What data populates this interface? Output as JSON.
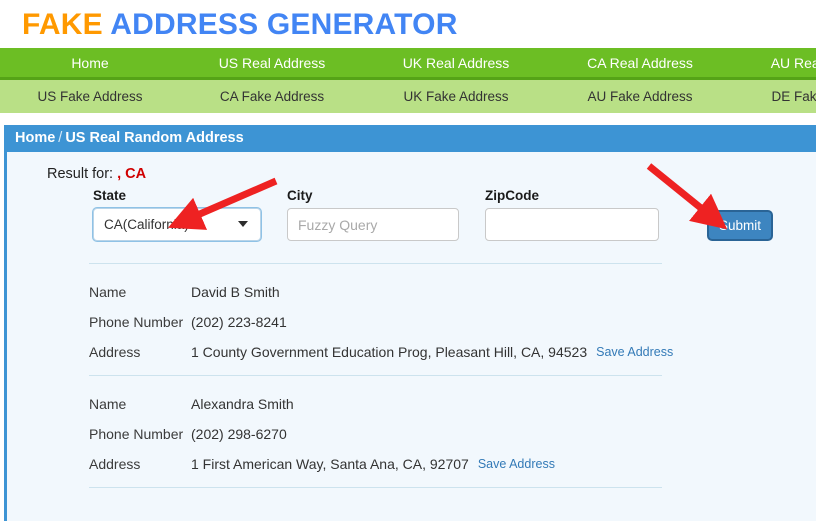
{
  "logo": {
    "part1": "FAKE",
    "part2": " ADDRESS GENERATOR"
  },
  "nav": {
    "primary": [
      {
        "label": "Home"
      },
      {
        "label": "US Real Address"
      },
      {
        "label": "UK Real Address"
      },
      {
        "label": "CA Real Address"
      },
      {
        "label": "AU Real Address"
      }
    ],
    "secondary": [
      {
        "label": "US Fake Address"
      },
      {
        "label": "CA Fake Address"
      },
      {
        "label": "UK Fake Address"
      },
      {
        "label": "AU Fake Address"
      },
      {
        "label": "DE Fake Address"
      }
    ]
  },
  "breadcrumb": {
    "home": "Home",
    "separator": "/",
    "current": "US Real Random Address"
  },
  "result_for": {
    "prefix": "Result for:",
    "value": ", CA"
  },
  "form": {
    "state": {
      "label": "State",
      "value": "CA(California)"
    },
    "city": {
      "label": "City",
      "value": "",
      "placeholder": "Fuzzy Query"
    },
    "zipcode": {
      "label": "ZipCode",
      "value": "",
      "placeholder": ""
    },
    "submit": {
      "label": "Submit"
    }
  },
  "results": {
    "keys": {
      "name": "Name",
      "phone": "Phone Number",
      "address": "Address"
    },
    "save_label": "Save Address",
    "records": [
      {
        "name": "David B Smith",
        "phone": "(202) 223-8241",
        "address": "1 County Government Education Prog, Pleasant Hill, CA, 94523"
      },
      {
        "name": "Alexandra Smith",
        "phone": "(202) 298-6270",
        "address": "1 First American Way, Santa Ana, CA, 92707"
      }
    ]
  },
  "colors": {
    "logo_orange": "#ff9900",
    "logo_blue": "#4285f4",
    "nav_green": "#6cbe24",
    "nav_green_light": "#b9e086",
    "panel_blue": "#3d94d4",
    "link_blue": "#337ab7",
    "highlight_red": "#d00000",
    "arrow_red": "#ee2222"
  }
}
